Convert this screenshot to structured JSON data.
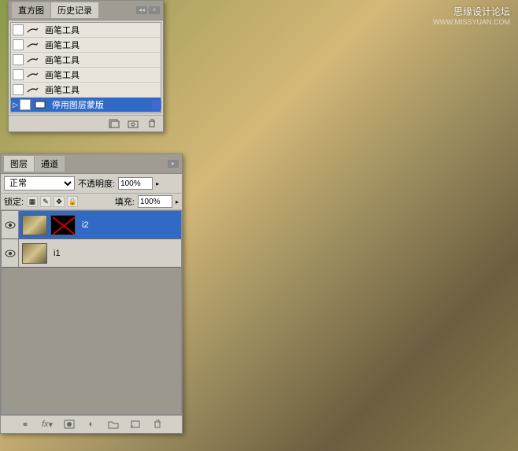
{
  "watermark": {
    "main": "思缘设计论坛",
    "sub": "WWW.MISSYUAN.COM"
  },
  "history_panel": {
    "tabs": {
      "histogram": "直方图",
      "history": "历史记录"
    },
    "items": [
      {
        "label": "画笔工具"
      },
      {
        "label": "画笔工具"
      },
      {
        "label": "画笔工具"
      },
      {
        "label": "画笔工具"
      },
      {
        "label": "画笔工具"
      },
      {
        "label": "停用图层蒙版"
      }
    ]
  },
  "layers_panel": {
    "tabs": {
      "layers": "图层",
      "channels": "通道"
    },
    "blend_mode": "正常",
    "opacity_label": "不透明度:",
    "opacity_value": "100%",
    "lock_label": "锁定:",
    "fill_label": "填充:",
    "fill_value": "100%",
    "layers": [
      {
        "name": "i2",
        "has_mask": true,
        "selected": true
      },
      {
        "name": "i1",
        "has_mask": false,
        "selected": false
      }
    ]
  }
}
